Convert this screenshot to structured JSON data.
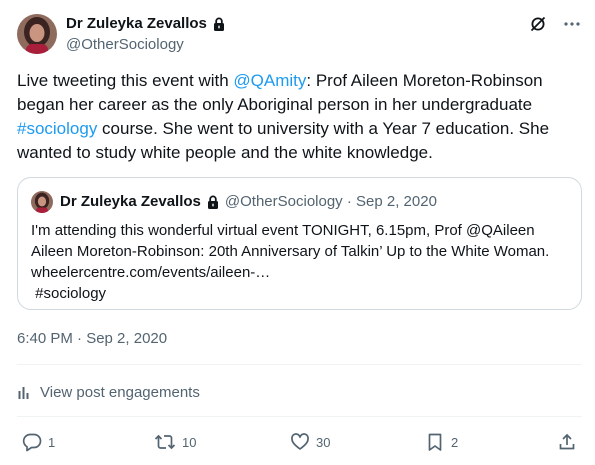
{
  "author": {
    "name": "Dr Zuleyka Zevallos",
    "handle": "@OtherSociology"
  },
  "tweet": {
    "text_part1": "Live tweeting this event with ",
    "mention": "@QAmity",
    "text_part2": ": Prof Aileen Moreton-Robinson began her career as the only Aboriginal person in her undergraduate ",
    "hashtag": "#sociology",
    "text_part3": " course. She went to university with a Year 7 education. She wanted to study white people and the white knowledge."
  },
  "quoted": {
    "name": "Dr Zuleyka Zevallos",
    "meta": "@OtherSociology · Sep 2, 2020",
    "lines": [
      "I'm attending this wonderful virtual event TONIGHT, 6.15pm, Prof @QAileen",
      "Aileen Moreton-Robinson: 20th Anniversary of Talkin’ Up to the White Woman.",
      "wheelercentre.com/events/aileen-…",
      " #sociology"
    ]
  },
  "timestamp": "6:40 PM · Sep 2, 2020",
  "engagements_label": "View post engagements",
  "actions": {
    "replies": "1",
    "retweets": "10",
    "likes": "30",
    "bookmarks": "2"
  },
  "icons": {
    "lock": "lock-icon",
    "hide": "no-grok-icon",
    "more": "more-icon",
    "reply": "reply-icon",
    "retweet": "retweet-icon",
    "like": "heart-icon",
    "bookmark": "bookmark-icon",
    "share": "share-icon",
    "analytics": "analytics-icon"
  },
  "colors": {
    "link": "#1d9bf0",
    "text": "#0f1419",
    "muted": "#536471",
    "border": "#cfd9de"
  }
}
